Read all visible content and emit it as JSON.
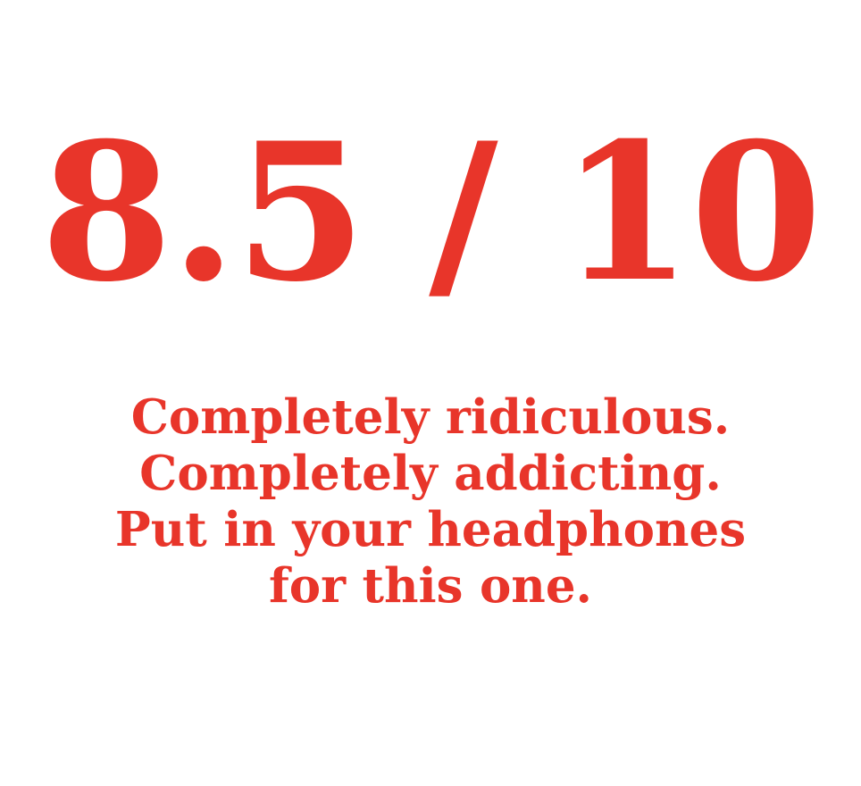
{
  "rating": {
    "score_text": "8.5 / 10",
    "score": 8.5,
    "max_score": 10,
    "color": "#e8352a"
  },
  "tagline": {
    "lines": [
      "Completely ridiculous.",
      "Completely addicting.",
      "Put in your headphones",
      "for this one."
    ]
  }
}
